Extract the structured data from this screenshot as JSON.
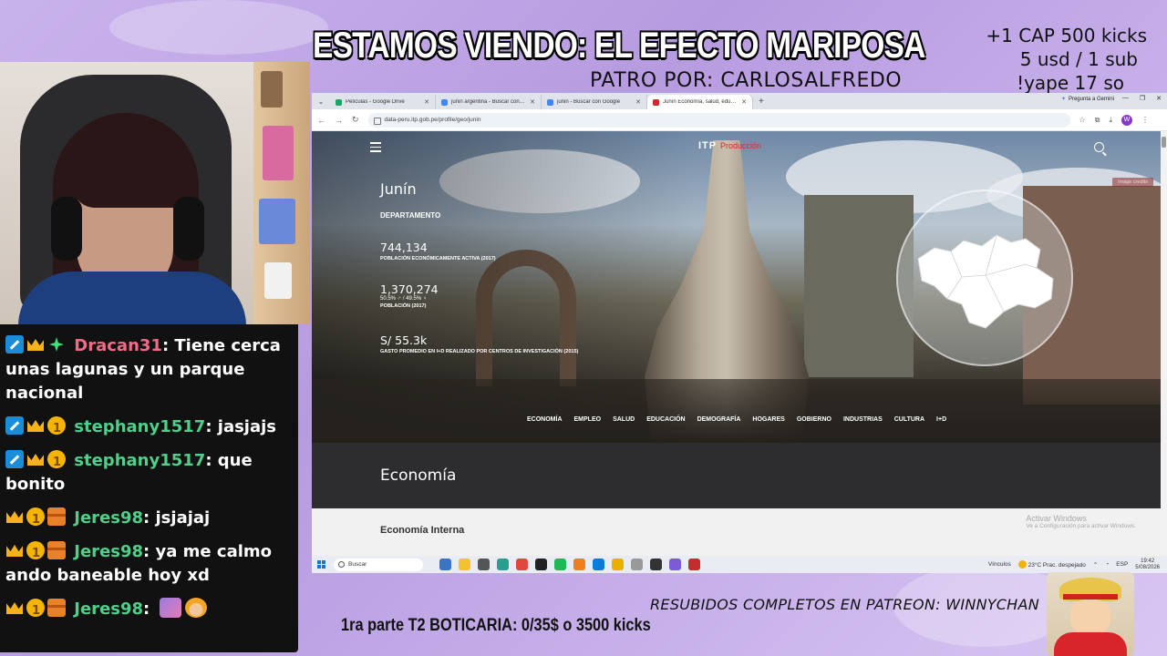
{
  "overlay": {
    "title": "ESTAMOS VIENDO: EL EFECTO MARIPOSA",
    "patro": "PATRO POR:  CARLOSALFREDO",
    "right_lines": [
      "+1 CAP 500 kicks",
      "5 usd / 1 sub",
      "!yape 17 so"
    ],
    "resubidos": "RESUBIDOS COMPLETOS EN PATREON: WINNYCHAN",
    "boticaria": "1ra parte T2 BOTICARIA: 0/35$ o 3500 kicks"
  },
  "chat": [
    {
      "user": "Dracan31",
      "badges": [
        "mod",
        "crown",
        "gem"
      ],
      "text": "Tiene cerca unas lagunas y un parque nacional",
      "user_color": "#f06c86"
    },
    {
      "user": "stephany1517",
      "badges": [
        "mod",
        "crown",
        "coin"
      ],
      "text": "jasjajs",
      "user_color": "#4ed08a"
    },
    {
      "user": "stephany1517",
      "badges": [
        "mod",
        "crown",
        "coin"
      ],
      "text": "que bonito",
      "user_color": "#4ed08a"
    },
    {
      "user": "Jeres98",
      "badges": [
        "crown",
        "coin",
        "box"
      ],
      "text": "jsjajaj",
      "user_color": "#4ed08a"
    },
    {
      "user": "Jeres98",
      "badges": [
        "crown",
        "coin",
        "box"
      ],
      "text": "ya me calmo ando baneable hoy xd",
      "user_color": "#4ed08a"
    },
    {
      "user": "Jeres98",
      "badges": [
        "crown",
        "coin",
        "box"
      ],
      "text": "",
      "user_color": "#4ed08a",
      "emotes": [
        "brush-emote",
        "naruto-emote"
      ]
    }
  ],
  "browser": {
    "tabs": [
      {
        "label": "Películas - Google Drive",
        "favicon_color": "#1fa463",
        "active": false
      },
      {
        "label": "junin argentina - Buscar con Go",
        "favicon_color": "#4285f4",
        "active": false
      },
      {
        "label": "junin - Buscar con Google",
        "favicon_color": "#4285f4",
        "active": false
      },
      {
        "label": "Junín Economía, salud, educaci",
        "favicon_color": "#d8232a",
        "active": true
      }
    ],
    "gemini": "Pregunta a Gemini",
    "url": "data-peru.itp.gob.pe/profile/geo/junin",
    "avatar_letter": "W"
  },
  "page": {
    "logo": "ITP",
    "logo_suffix": "Producción",
    "image_credits": "Image credits",
    "region_name": "Junín",
    "region_type": "DEPARTAMENTO",
    "stats": [
      {
        "value": "744,134",
        "label": "POBLACIÓN ECONÓMICAMENTE ACTIVA (2017)"
      },
      {
        "value": "1,370,274",
        "detail": "50.5% ♂ / 49.5% ♀",
        "label": "POBLACIÓN (2017)"
      },
      {
        "value": "S/ 55.3k",
        "label": "GASTO PROMEDIO EN I+D REALIZADO POR CENTROS DE INVESTIGACIÓN (2015)"
      }
    ],
    "nav": [
      "ECONOMÍA",
      "EMPLEO",
      "SALUD",
      "EDUCACIÓN",
      "DEMOGRAFÍA",
      "HOGARES",
      "GOBIERNO",
      "INDUSTRIAS",
      "CULTURA",
      "I+D"
    ],
    "section_title": "Economía",
    "subsection_title": "Economía Interna",
    "activate_title": "Activar Windows",
    "activate_sub": "Ve a Configuración para activar Windows."
  },
  "taskbar": {
    "search": "Buscar",
    "vinculos": "Vínculos",
    "weather": "23°C  Prac. despejado",
    "lang": "ESP",
    "time": "19:42",
    "date": "5/08/2026",
    "apps": [
      "#3a75c4",
      "#f2c230",
      "#555",
      "#2a9d8f",
      "#e0493a",
      "#222",
      "#1db954",
      "#f07f1a",
      "#0a7bd6",
      "#e8b100",
      "#999",
      "#333",
      "#7b5cd6",
      "#c42b2b"
    ]
  }
}
